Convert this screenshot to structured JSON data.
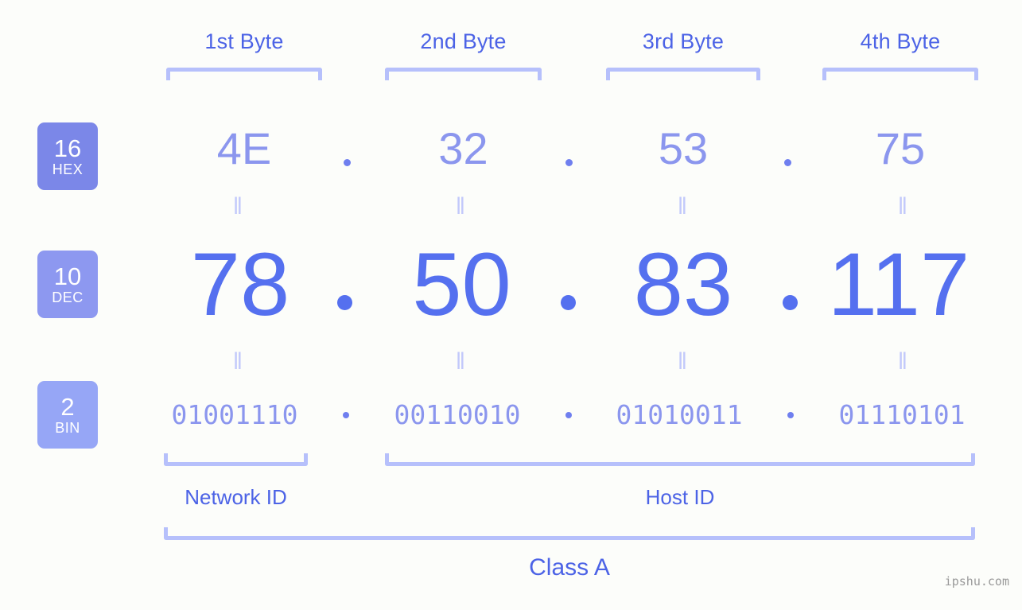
{
  "background_color": "#fcfdfa",
  "accent_color": "#5570ef",
  "accent_light_color": "#8b96ee",
  "bracket_color": "#b6c0fb",
  "headers": {
    "bytes": [
      {
        "label": "1st Byte"
      },
      {
        "label": "2nd Byte"
      },
      {
        "label": "3rd Byte"
      },
      {
        "label": "4th Byte"
      }
    ]
  },
  "rows": {
    "hex": {
      "badge_number": "16",
      "badge_name": "HEX",
      "badge_color": "#7b87e8",
      "values": [
        "4E",
        "32",
        "53",
        "75"
      ],
      "separator": "."
    },
    "dec": {
      "badge_number": "10",
      "badge_name": "DEC",
      "badge_color": "#8d98f0",
      "values": [
        "78",
        "50",
        "83",
        "117"
      ],
      "separator": "."
    },
    "bin": {
      "badge_number": "2",
      "badge_name": "BIN",
      "badge_color": "#96a6f6",
      "values": [
        "01001110",
        "00110010",
        "01010011",
        "01110101"
      ],
      "separator": "."
    }
  },
  "equals_sign": "‖",
  "sections": {
    "network_id": "Network ID",
    "host_id": "Host ID",
    "class": "Class A"
  },
  "watermark": "ipshu.com"
}
